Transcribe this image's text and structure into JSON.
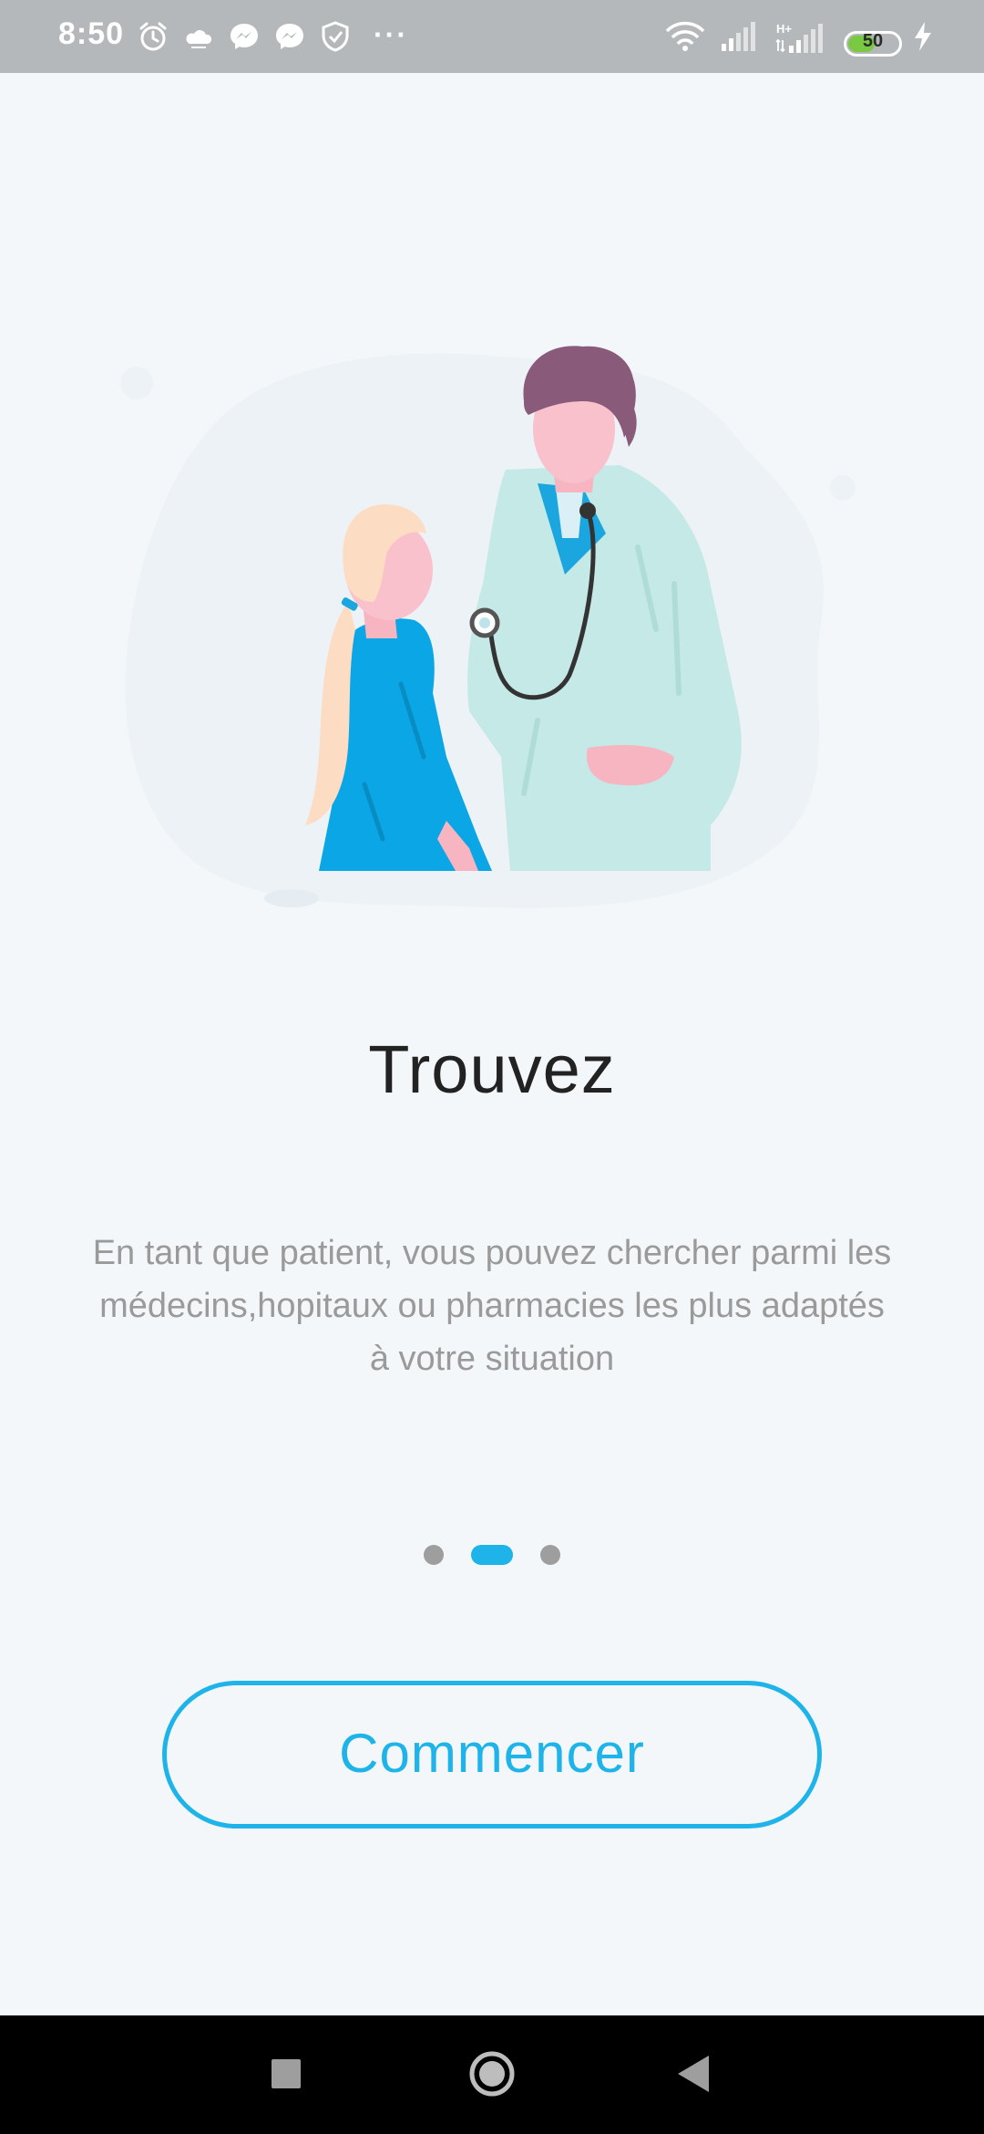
{
  "status_bar": {
    "time": "8:50",
    "more": "···",
    "network_label": "H+",
    "battery_level": "50",
    "battery_fraction": 0.5,
    "notification_icons": [
      "alarm-icon",
      "weather-icon",
      "messenger-icon",
      "messenger-icon",
      "shield-icon"
    ],
    "system_icons": [
      "wifi-icon",
      "signal-icon",
      "signal-hplus-icon",
      "battery-icon",
      "charging-icon"
    ]
  },
  "onboarding": {
    "illustration": "doctor-patient-illustration",
    "title": "Trouvez",
    "description": "En tant que patient, vous pouvez chercher parmi les médecins,hopitaux ou pharmacies les plus adaptés à votre situation",
    "page_count": 3,
    "active_page": 2,
    "button_label": "Commencer"
  },
  "nav_bar": {
    "buttons": [
      "recents-icon",
      "home-icon",
      "back-icon"
    ]
  },
  "colors": {
    "accent": "#1eb4ea",
    "background": "#f4f7f9",
    "title": "#222222",
    "body_text": "#9a9a9a",
    "status_bar": "#b5b8ba",
    "inactive_dot": "#9e9e9e"
  }
}
